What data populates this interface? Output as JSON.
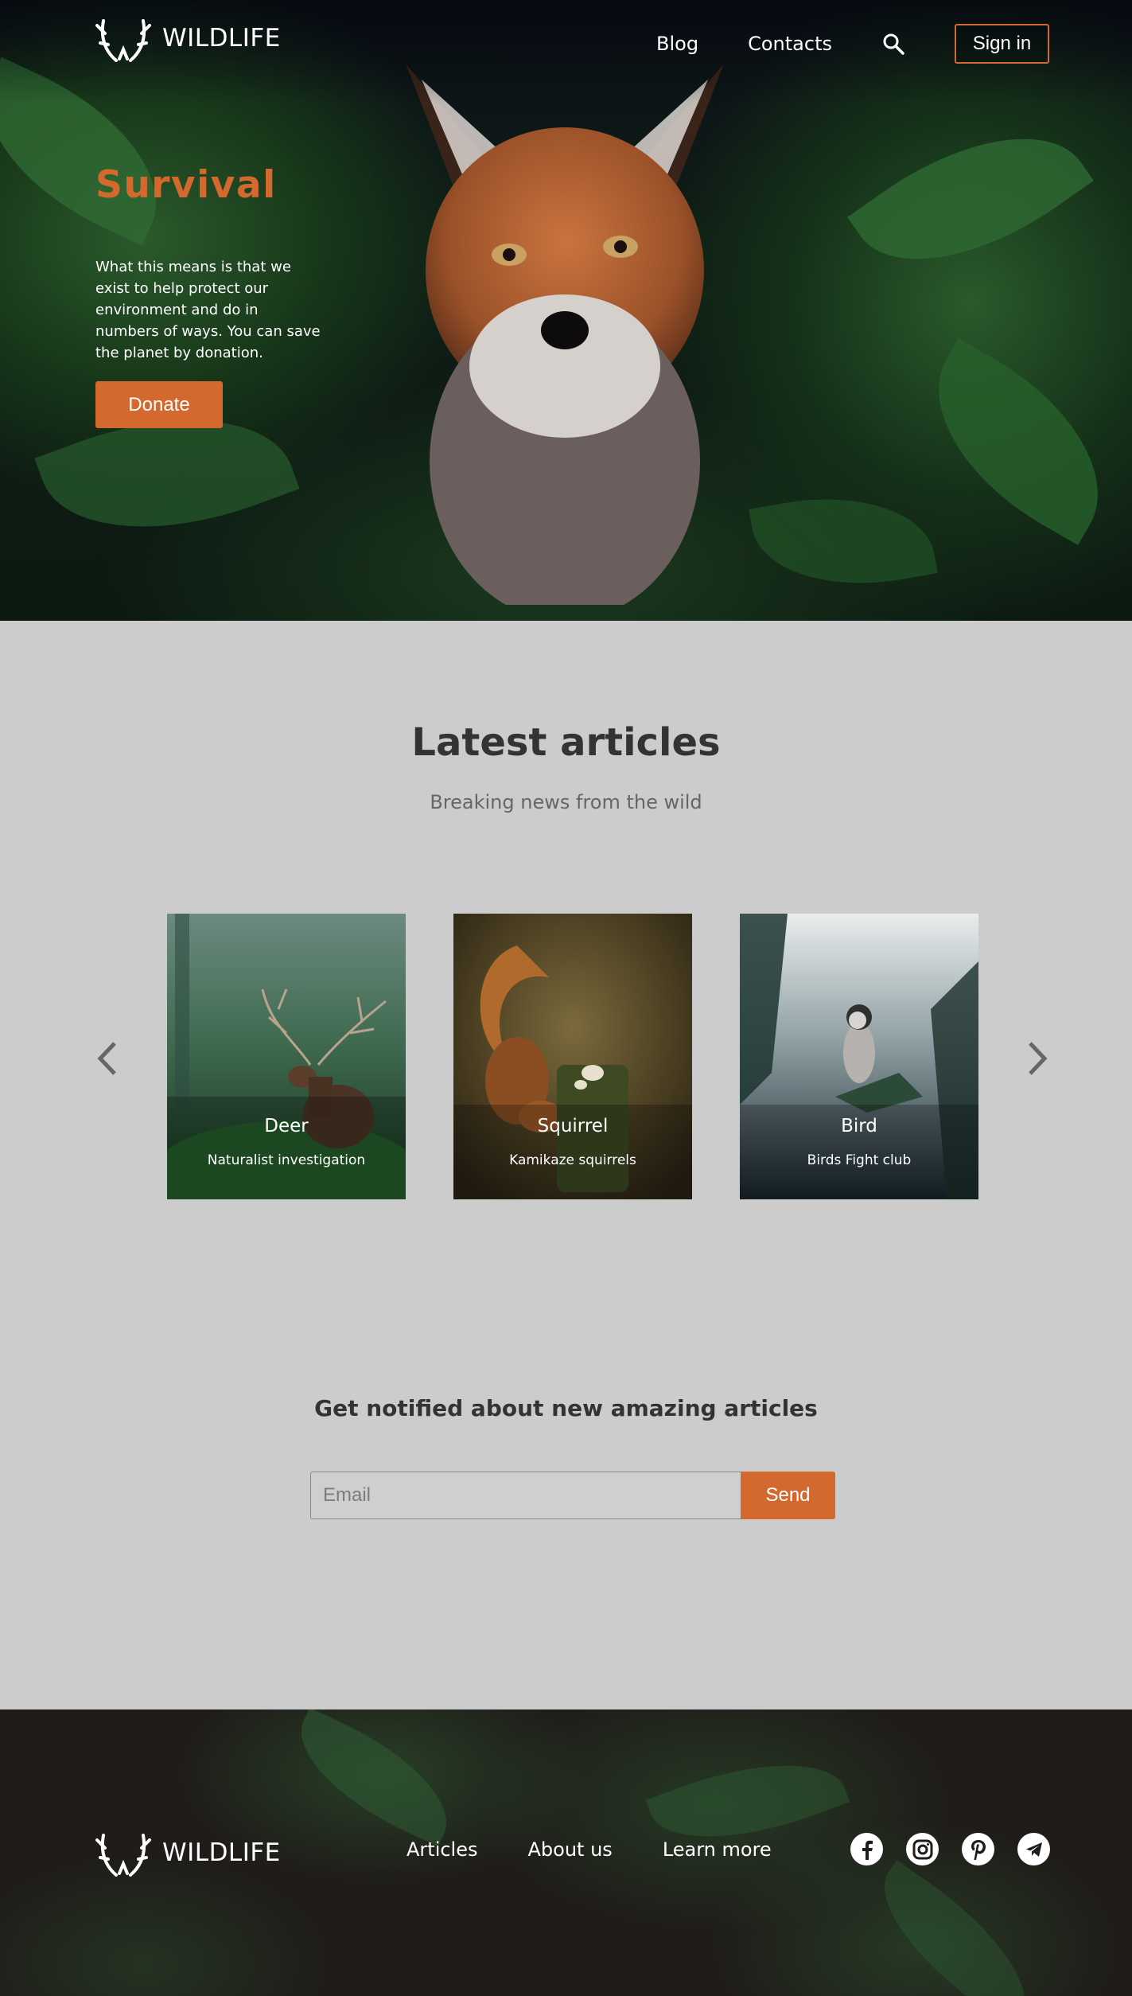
{
  "header": {
    "brand": "WILDLIFE",
    "nav": [
      {
        "label": "Blog"
      },
      {
        "label": "Contacts"
      }
    ],
    "search_icon": "search-icon",
    "signin_label": "Sign in"
  },
  "hero": {
    "title": "Survival",
    "text": "What this means is that we exist to help protect our environment and do in numbers of ways. You can save the planet by donation.",
    "donate_label": "Donate"
  },
  "articles": {
    "title": "Latest articles",
    "subtitle": "Breaking news from the wild",
    "prev_icon": "chevron-left-icon",
    "next_icon": "chevron-right-icon",
    "cards": [
      {
        "title": "Deer",
        "desc": "Naturalist investigation"
      },
      {
        "title": "Squirrel",
        "desc": "Kamikaze squirrels"
      },
      {
        "title": "Bird",
        "desc": "Birds Fight club"
      }
    ]
  },
  "newsletter": {
    "title": "Get notified about new amazing articles",
    "email_placeholder": "Email",
    "send_label": "Send"
  },
  "footer": {
    "brand": "WILDLIFE",
    "links": [
      {
        "label": "Articles"
      },
      {
        "label": "About us"
      },
      {
        "label": "Learn more"
      }
    ],
    "social": [
      "facebook-icon",
      "instagram-icon",
      "pinterest-icon",
      "telegram-icon"
    ]
  },
  "colors": {
    "accent": "#d4692f",
    "background": "#cccccc",
    "footer": "#1f1c19"
  }
}
